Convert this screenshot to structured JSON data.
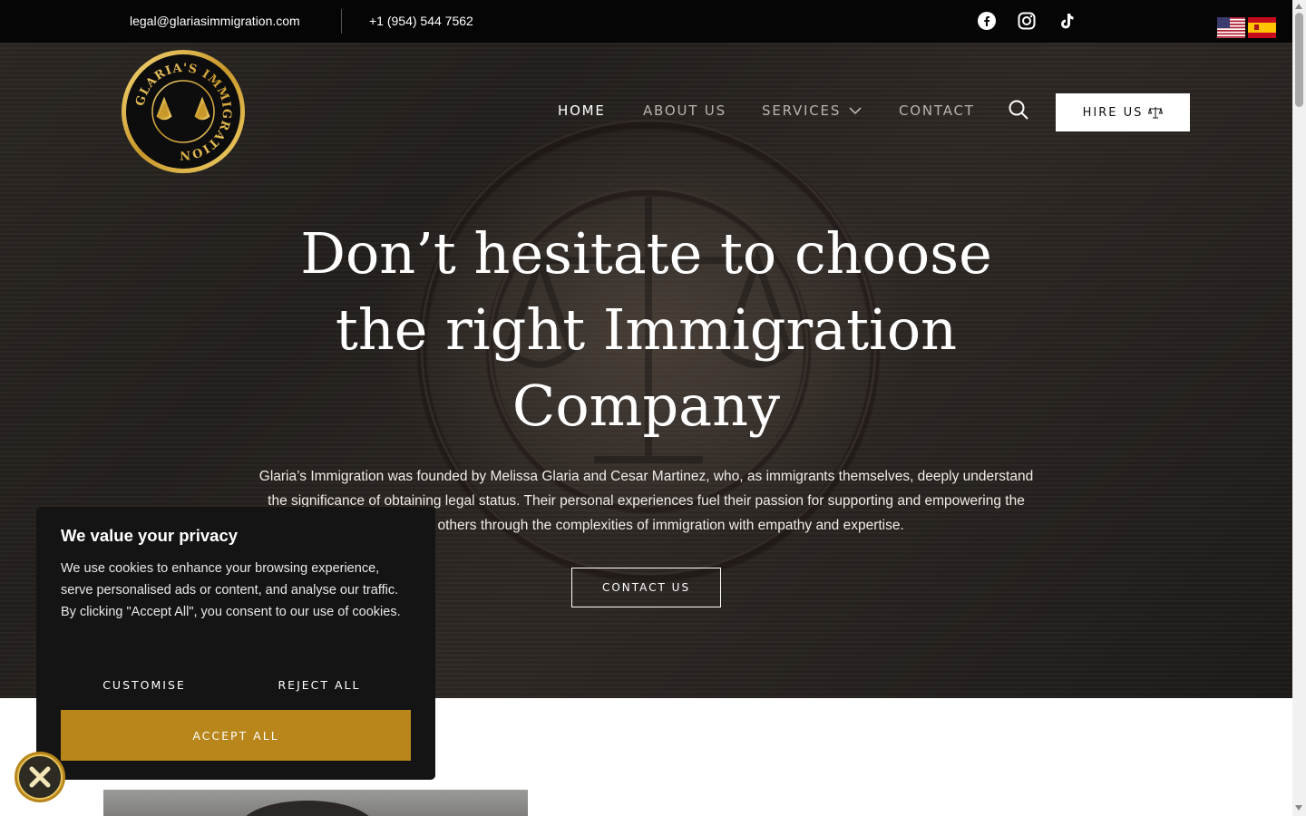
{
  "topbar": {
    "email": "legal@glariasimmigration.com",
    "phone": "+1 (954) 544 7562",
    "social_icons": [
      "facebook-icon",
      "instagram-icon",
      "tiktok-icon"
    ],
    "languages": [
      "English",
      "Español"
    ]
  },
  "logo": {
    "text": "GLARIA'S IMMIGRATION"
  },
  "nav": {
    "items": [
      "HOME",
      "ABOUT US",
      "SERVICES",
      "CONTACT"
    ],
    "active": "HOME",
    "hire_label": "HIRE US"
  },
  "hero": {
    "title_lines": [
      "Don’t hesitate to choose",
      "the right Immigration",
      "Company"
    ],
    "text_lines": [
      "Glaria’s Immigration was founded by Melissa Glaria and Cesar Martinez, who, as immigrants themselves, deeply understand",
      "the significance of obtaining legal status. Their personal experiences fuel their passion for supporting and empowering the",
      "guiding others through the complexities of immigration with empathy and expertise."
    ],
    "cta_label": "CONTACT US"
  },
  "cookie": {
    "title": "We value your privacy",
    "text": "We use cookies to enhance your browsing experience, serve personalised ads or content, and analyse our traffic. By clicking \"Accept All\", you consent to our use of cookies.",
    "customise_label": "CUSTOMISE",
    "reject_label": "REJECT ALL",
    "accept_label": "ACCEPT ALL"
  },
  "colors": {
    "topbar_bg": "#050505",
    "accent_gold": "#b8861b",
    "cookie_bg": "#141414"
  }
}
